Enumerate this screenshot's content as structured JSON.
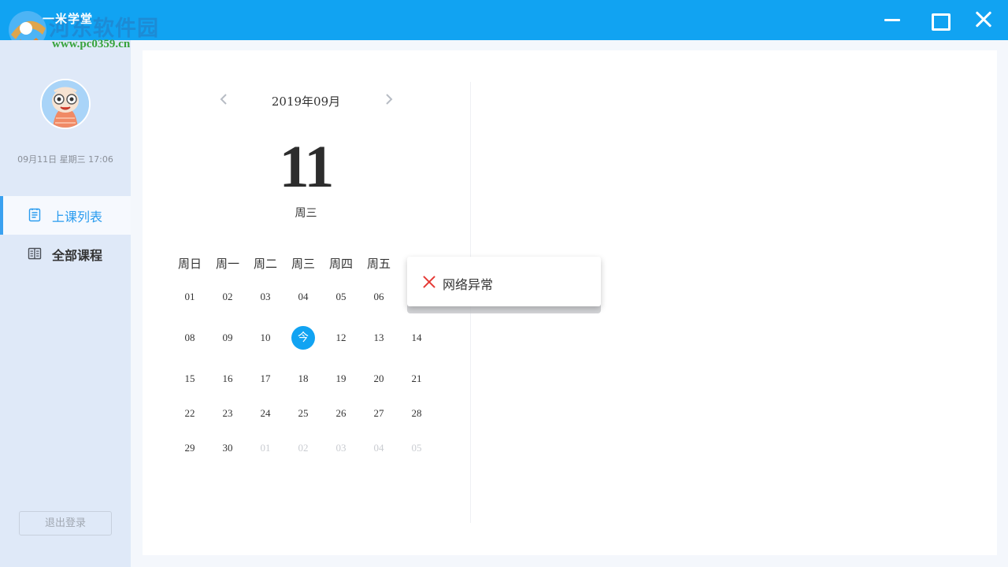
{
  "app": {
    "title": "一米学堂",
    "watermark_text": "河东软件园",
    "watermark_url": "www.pc0359.cn"
  },
  "window_controls": {
    "minimize_icon": "minimize-icon",
    "maximize_icon": "maximize-icon",
    "close_icon": "close-icon"
  },
  "sidebar": {
    "datetime": "09月11日 星期三 17:06",
    "items": [
      {
        "label": "上课列表",
        "icon": "list-icon",
        "active": true
      },
      {
        "label": "全部课程",
        "icon": "book-icon",
        "active": false
      }
    ],
    "logout_label": "退出登录"
  },
  "calendar": {
    "month_title": "2019年09月",
    "selected_day": "11",
    "selected_weekday": "周三",
    "weekdays": [
      "周日",
      "周一",
      "周二",
      "周三",
      "周四",
      "周五"
    ],
    "weeks": [
      [
        {
          "t": "01"
        },
        {
          "t": "02"
        },
        {
          "t": "03"
        },
        {
          "t": "04"
        },
        {
          "t": "05"
        },
        {
          "t": "06"
        },
        {
          "t": ""
        }
      ],
      [
        {
          "t": "08"
        },
        {
          "t": "09"
        },
        {
          "t": "10"
        },
        {
          "t": "今",
          "today": true
        },
        {
          "t": "12"
        },
        {
          "t": "13"
        },
        {
          "t": "14"
        }
      ],
      [
        {
          "t": "15"
        },
        {
          "t": "16"
        },
        {
          "t": "17"
        },
        {
          "t": "18"
        },
        {
          "t": "19"
        },
        {
          "t": "20"
        },
        {
          "t": "21"
        }
      ],
      [
        {
          "t": "22"
        },
        {
          "t": "23"
        },
        {
          "t": "24"
        },
        {
          "t": "25"
        },
        {
          "t": "26"
        },
        {
          "t": "27"
        },
        {
          "t": "28"
        }
      ],
      [
        {
          "t": "29"
        },
        {
          "t": "30"
        },
        {
          "t": "01",
          "other": true
        },
        {
          "t": "02",
          "other": true
        },
        {
          "t": "03",
          "other": true
        },
        {
          "t": "04",
          "other": true
        },
        {
          "t": "05",
          "other": true
        }
      ]
    ]
  },
  "toast": {
    "message": "网络异常",
    "icon": "error-x-icon",
    "icon_color": "#e53935"
  },
  "colors": {
    "primary": "#11a3f2",
    "sidebar_bg": "#dfe9f8",
    "active_text": "#2a9cef"
  }
}
